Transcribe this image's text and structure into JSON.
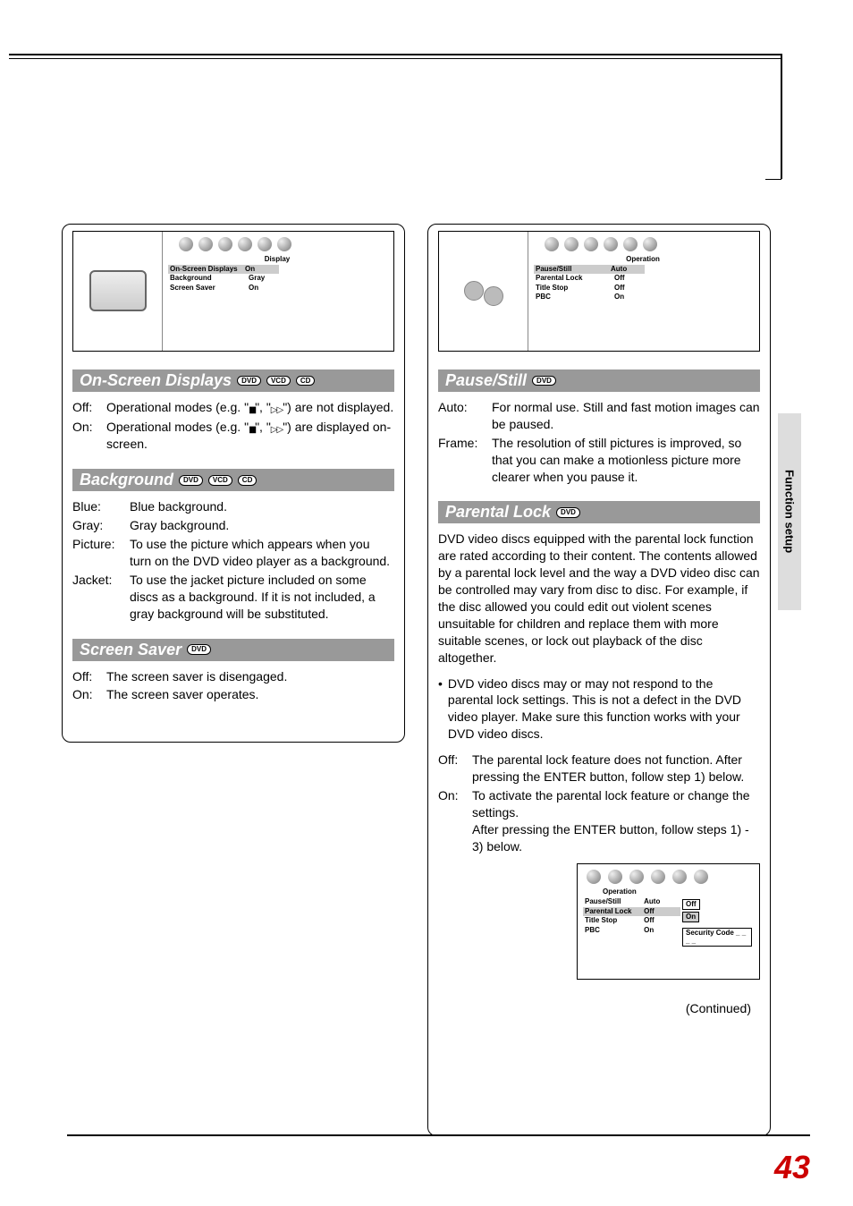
{
  "side_tab": "Function setup",
  "page_number": "43",
  "continued": "(Continued)",
  "left": {
    "menu": {
      "title": "Display",
      "rows": [
        {
          "label": "On-Screen Displays",
          "value": "On"
        },
        {
          "label": "Background",
          "value": "Gray"
        },
        {
          "label": "Screen Saver",
          "value": "On"
        }
      ]
    },
    "sections": {
      "osd": {
        "title": "On-Screen Displays",
        "badges": [
          "DVD",
          "VCD",
          "CD"
        ],
        "off": "Off:",
        "off_text_a": "Operational modes (e.g. \"",
        "off_text_b": "\", \"",
        "off_text_c": "\") are not displayed.",
        "on": "On:",
        "on_text_a": "Operational modes (e.g. \"",
        "on_text_b": "\", \"",
        "on_text_c": "\") are displayed on-screen."
      },
      "background": {
        "title": "Background",
        "badges": [
          "DVD",
          "VCD",
          "CD"
        ],
        "rows": [
          {
            "k": "Blue:",
            "v": "Blue background."
          },
          {
            "k": "Gray:",
            "v": "Gray background."
          },
          {
            "k": "Picture:",
            "v": "To use the picture which appears when you turn on the DVD video player as a background."
          },
          {
            "k": "Jacket:",
            "v": "To use the jacket picture included on some discs as a background. If it is not included, a gray background will be substituted."
          }
        ]
      },
      "screensaver": {
        "title": "Screen Saver",
        "badges": [
          "DVD"
        ],
        "rows": [
          {
            "k": "Off:",
            "v": "The screen saver is disengaged."
          },
          {
            "k": "On:",
            "v": "The screen saver operates."
          }
        ]
      }
    }
  },
  "right": {
    "menu": {
      "title": "Operation",
      "rows": [
        {
          "label": "Pause/Still",
          "value": "Auto"
        },
        {
          "label": "Parental Lock",
          "value": "Off"
        },
        {
          "label": "Title Stop",
          "value": "Off"
        },
        {
          "label": "PBC",
          "value": "On"
        }
      ]
    },
    "sections": {
      "pause": {
        "title": "Pause/Still",
        "badges": [
          "DVD"
        ],
        "rows": [
          {
            "k": "Auto:",
            "v": "For normal use. Still and fast motion images can be paused."
          },
          {
            "k": "Frame:",
            "v": "The resolution of still pictures is improved, so that you can make a motionless picture more clearer when you pause it."
          }
        ]
      },
      "parental": {
        "title": "Parental Lock",
        "badges": [
          "DVD"
        ],
        "intro": "DVD video discs equipped with the parental lock function are rated according to their content. The contents allowed by a parental lock level and the way a DVD video disc can be controlled may vary from disc to disc. For example, if the disc allowed you could edit out violent scenes unsuitable for children and replace them with more suitable scenes, or lock out playback of the disc altogether.",
        "bullet": "DVD video discs may or may not respond to the parental lock settings. This is not a defect in the DVD video player. Make sure this function works with your DVD video discs.",
        "off_k": "Off:",
        "off_v": "The parental lock feature does not function. After pressing the ENTER button, follow step 1) below.",
        "on_k": "On:",
        "on_v1": "To activate the parental lock feature or change the settings.",
        "on_v2": "After pressing the ENTER button, follow steps 1) - 3) below.",
        "submenu": {
          "title": "Operation",
          "rows": [
            {
              "label": "Pause/Still",
              "value": "Auto"
            },
            {
              "label": "Parental Lock",
              "value": "Off"
            },
            {
              "label": "Title Stop",
              "value": "Off"
            },
            {
              "label": "PBC",
              "value": "On"
            }
          ],
          "options": [
            "Off",
            "On"
          ],
          "security": "Security Code _ _ _ _"
        }
      }
    }
  }
}
